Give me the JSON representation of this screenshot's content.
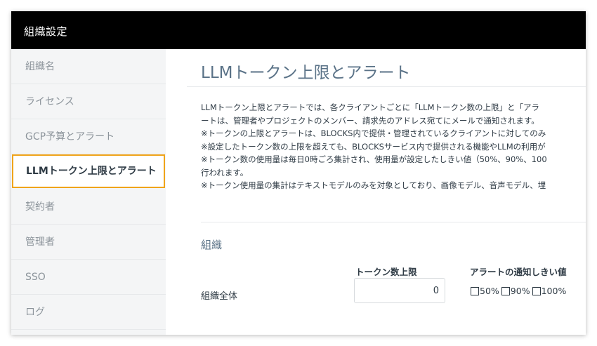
{
  "header": {
    "title": "組織設定"
  },
  "sidebar": {
    "items": [
      {
        "label": "組織名"
      },
      {
        "label": "ライセンス"
      },
      {
        "label": "GCP予算とアラート"
      },
      {
        "label": "LLMトークン上限とアラート",
        "active": true
      },
      {
        "label": "契約者"
      },
      {
        "label": "管理者"
      },
      {
        "label": "SSO"
      },
      {
        "label": "ログ"
      }
    ]
  },
  "main": {
    "title": "LLMトークン上限とアラート",
    "description": [
      "LLMトークン上限とアラートでは、各クライアントごとに「LLMトークン数の上限」と「アラ",
      "ートは、管理者やプロジェクトのメンバー、請求先のアドレス宛てにメールで通知されます。",
      "※トークンの上限とアラートは、BLOCKS内で提供・管理されているクライアントに対してのみ",
      "※設定したトークン数の上限を超えても、BLOCKSサービス内で提供される機能やLLMの利用が",
      "※トークン数の使用量は毎日0時ごろ集計され、使用量が設定したしきい値（50%、90%、100",
      "行われます。",
      "※トークン使用量の集計はテキストモデルのみを対象としており、画像モデル、音声モデル、埋"
    ],
    "section": {
      "title": "組織",
      "col_limit": "トークン数上限",
      "col_alert": "アラートの通知しきい値",
      "row_label": "組織全体",
      "limit_value": "0",
      "thresholds": [
        {
          "label": "50%",
          "checked": false
        },
        {
          "label": "90%",
          "checked": false
        },
        {
          "label": "100%",
          "checked": false
        }
      ]
    }
  },
  "colors": {
    "header_bg": "#000000",
    "sidebar_bg": "#f4f5f6",
    "active_border": "#f0a41a",
    "title_color": "#5a7287",
    "text_color": "#2f3b45"
  }
}
